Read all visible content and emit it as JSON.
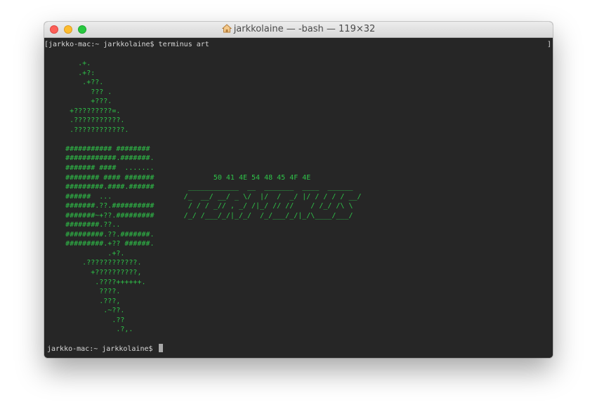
{
  "window": {
    "title": "jarkkolaine — -bash — 119×32"
  },
  "terminal": {
    "command_line": "[jarkko-mac:~ jarkkolaine$ terminus art",
    "right_bracket": "]",
    "ascii_art": "        .+.\n        .+?:\n         .+??.\n           ??? .\n           +???.\n      +?????????=.\n      .???????????.\n      .????????????.\n\n     ########### ########\n     ############.#######.\n     ####### ####  .......\n     ######## #### #######              50 41 4E 54 48 45 4F 4E\n     #########.####.######        ____________  __  _______  ____  ______\n     ######  ...                 /_  __/ __/ _ \\/  |/  /  _/ |/ / / / / __/\n     #######.??.##########        / / / _// , _/ /|_/ // //    / /_/ /\\ \\\n     #######~+??.#########       /_/ /___/_/|_/_/  /_/___/_/|_/\\____/___/\n     ########.??..\n     #########.??.#######.\n     #########.+?? ######.\n               .+?.\n         .????????????.\n           +??????????,\n            .????++++++.\n             ????.\n             .???,\n              .~??.\n                .??\n                 .?,.",
    "final_prompt": "jarkko-mac:~ jarkkolaine$ "
  },
  "colors": {
    "background": "#262626",
    "art_green": "#2fc249",
    "text": "#d8d8d8"
  },
  "icons": {
    "title_icon": "home-icon"
  }
}
